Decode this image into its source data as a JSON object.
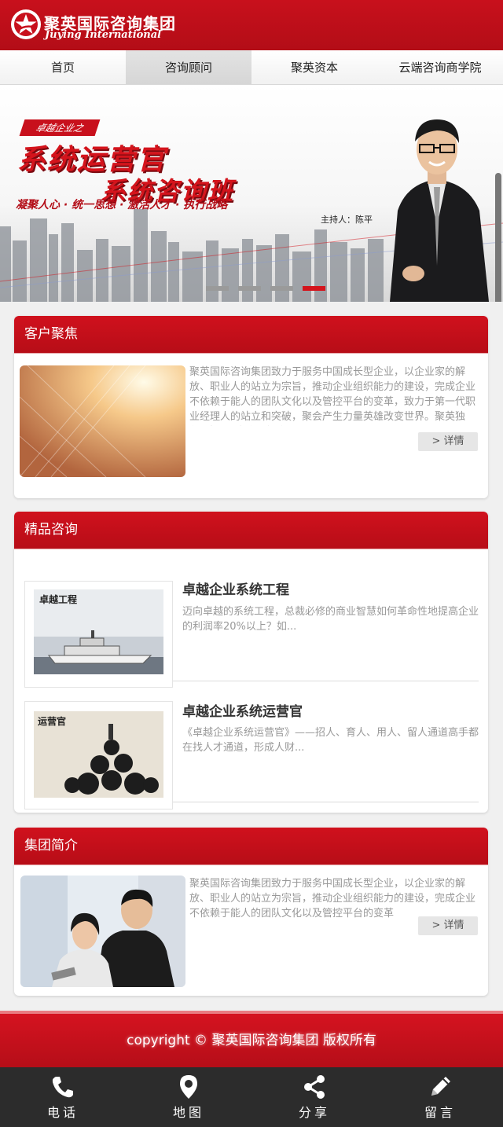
{
  "header": {
    "logo_cn": "聚英国际咨询集团",
    "logo_en": "Juying International"
  },
  "nav": {
    "items": [
      {
        "label": "首页",
        "active": false
      },
      {
        "label": "咨询顾问",
        "active": true
      },
      {
        "label": "聚英资本",
        "active": false
      },
      {
        "label": "云端咨询商学院",
        "active": false
      }
    ]
  },
  "banner": {
    "tag": "卓越企业之",
    "title1": "系统运营官",
    "title2": "系统咨询班",
    "slogan": "凝聚人心 · 统一思想 · 激活人才 · 执行战略",
    "host": "主持人：陈平",
    "slide_count": 4,
    "active_slide": 4
  },
  "focus": {
    "title": "客户聚焦",
    "desc": "聚英国际咨询集团致力于服务中国成长型企业，以企业家的解放、职业人的站立为宗旨，推动企业组织能力的建设，完成企业不依赖于能人的团队文化以及管控平台的变革，致力于第一代职业经理人的站立和突破，聚会产生力量英雄改变世界。聚英独创“培训、咨询、投资...",
    "more": "> 详情"
  },
  "consult": {
    "title": "精品咨询",
    "items": [
      {
        "title": "卓越企业系统工程",
        "desc": "迈向卓越的系统工程，总裁必修的商业智慧如何革命性地提高企业的利润率20%以上？如...",
        "thumb_text": "卓越工程"
      },
      {
        "title": "卓越企业系统运营官",
        "desc": "《卓越企业系统运营官》——招人、育人、用人、留人通道高手都在找人才通道，形成人财...",
        "thumb_text": "运营官"
      }
    ]
  },
  "intro": {
    "title": "集团简介",
    "desc": "聚英国际咨询集团致力于服务中国成长型企业，以企业家的解放、职业人的站立为宗旨，推动企业组织能力的建设，完成企业不依赖于能人的团队文化以及管控平台的变革",
    "more": "> 详情"
  },
  "footer": {
    "copyright": "copyright © 聚英国际咨询集团 版权所有"
  },
  "bottombar": {
    "items": [
      {
        "label": "电话",
        "icon": "phone-icon"
      },
      {
        "label": "地图",
        "icon": "map-pin-icon"
      },
      {
        "label": "分享",
        "icon": "share-icon"
      },
      {
        "label": "留言",
        "icon": "pencil-icon"
      }
    ]
  },
  "colors": {
    "brand_red": "#c8101c",
    "bottom_bar": "#2c2c2c"
  }
}
